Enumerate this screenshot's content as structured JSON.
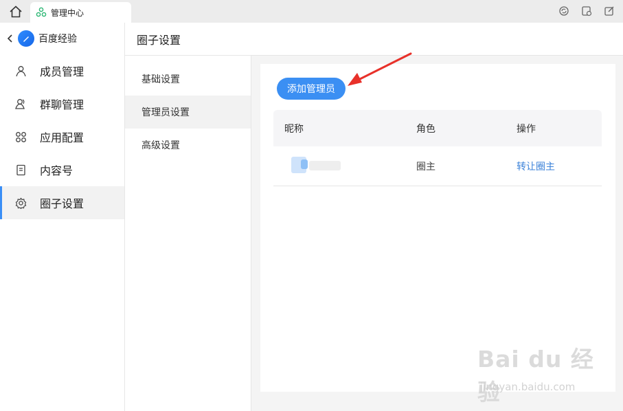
{
  "titlebar": {
    "tab_label": "管理中心",
    "icons": [
      "home-icon",
      "refresh-icon",
      "window-icon",
      "edit-icon"
    ]
  },
  "sidebar": {
    "title": "百度经验",
    "items": [
      {
        "label": "成员管理",
        "icon": "member-icon"
      },
      {
        "label": "群聊管理",
        "icon": "group-chat-icon"
      },
      {
        "label": "应用配置",
        "icon": "apps-icon"
      },
      {
        "label": "内容号",
        "icon": "document-icon"
      },
      {
        "label": "圈子设置",
        "icon": "gear-icon",
        "active": true
      }
    ]
  },
  "main": {
    "title": "圈子设置",
    "sub_nav": [
      {
        "label": "基础设置"
      },
      {
        "label": "管理员设置",
        "active": true
      },
      {
        "label": "高级设置"
      }
    ],
    "add_button": "添加管理员",
    "table": {
      "headers": [
        "昵称",
        "角色",
        "操作"
      ],
      "rows": [
        {
          "nickname": "",
          "role": "圈主",
          "action": "转让圈主"
        }
      ]
    }
  },
  "watermark": {
    "text": "Bai du 经验",
    "sub": "jingyan.baidu.com"
  },
  "colors": {
    "accent": "#3b8ff3",
    "link": "#3b82d9",
    "arrow": "#e8312a"
  }
}
